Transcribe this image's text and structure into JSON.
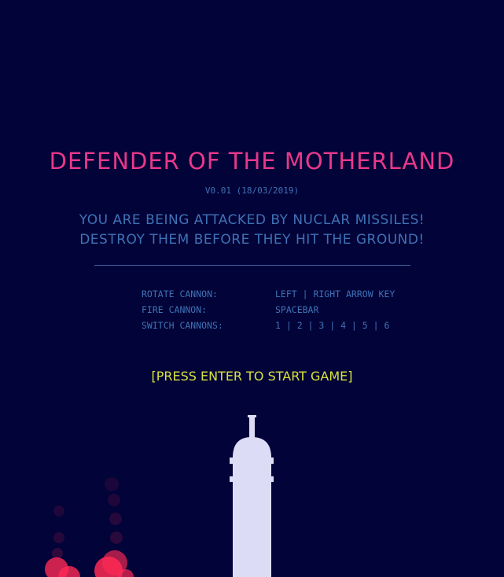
{
  "title": "DEFENDER OF THE MOTHERLAND",
  "version": "V0.01 (18/03/2019)",
  "subtitle": {
    "line1": "YOU ARE BEING ATTACKED BY NUCLAR MISSILES!",
    "line2": "DESTROY THEM BEFORE THEY HIT THE GROUND!"
  },
  "controls": [
    {
      "action": "ROTATE CANNON:",
      "key": "LEFT | RIGHT ARROW KEY"
    },
    {
      "action": "FIRE CANNON:",
      "key": "SPACEBAR"
    },
    {
      "action": "SWITCH CANNONS:",
      "key": "1 | 2 | 3 | 4 | 5 | 6"
    }
  ],
  "start_prompt": "[PRESS ENTER TO START GAME]",
  "colors": {
    "background": "#020338",
    "title": "#e8388a",
    "text": "#3f72b6",
    "prompt": "#d8e23c",
    "tower": "#dcdcf6",
    "explosion": "#ff2a55"
  },
  "icons": {
    "tower": "cannon-tower-icon",
    "explosion": "missile-explosion-icon"
  }
}
